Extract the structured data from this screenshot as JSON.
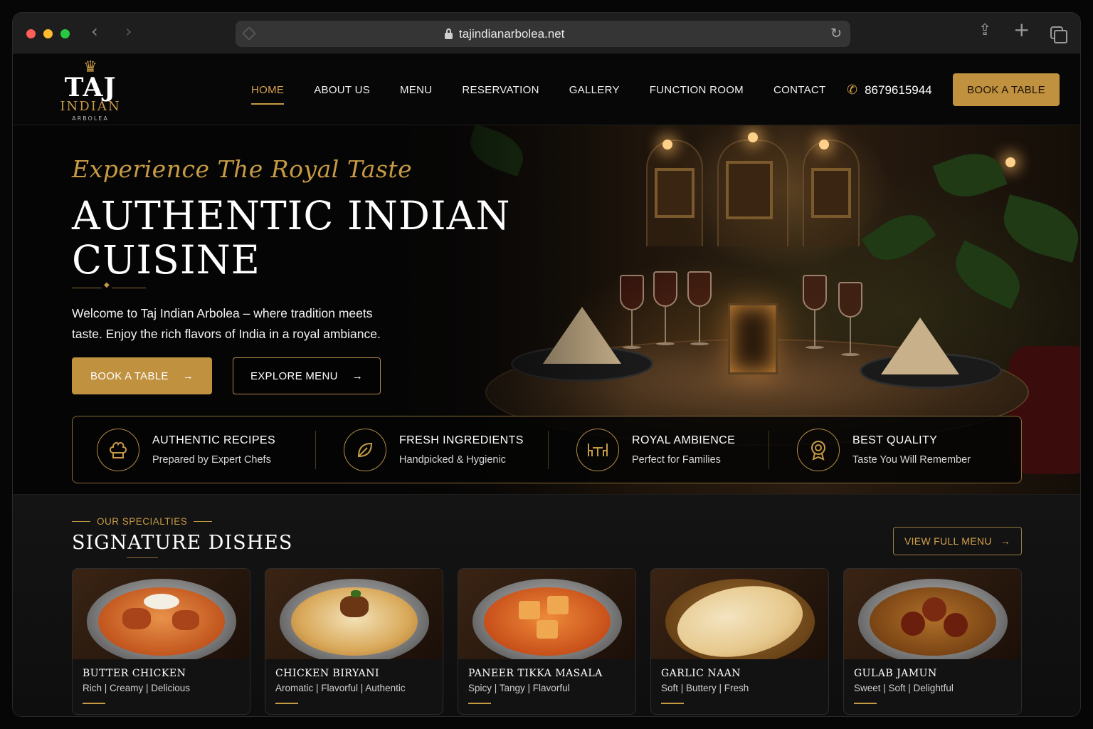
{
  "browser": {
    "url": "tajindianarbolea.net"
  },
  "logo": {
    "name": "TAJ",
    "subname": "INDIAN",
    "location": "ARBOLEA"
  },
  "nav": {
    "items": [
      {
        "label": "HOME",
        "active": true
      },
      {
        "label": "ABOUT US",
        "active": false
      },
      {
        "label": "MENU",
        "active": false
      },
      {
        "label": "RESERVATION",
        "active": false
      },
      {
        "label": "GALLERY",
        "active": false
      },
      {
        "label": "FUNCTION ROOM",
        "active": false
      },
      {
        "label": "CONTACT",
        "active": false
      }
    ],
    "phone": "8679615944",
    "book_label": "BOOK A TABLE"
  },
  "hero": {
    "tagline": "Experience The Royal Taste",
    "headline_line1": "AUTHENTIC INDIAN",
    "headline_line2": "CUISINE",
    "intro": "Welcome to Taj Indian Arbolea – where tradition meets taste. Enjoy the rich flavors of India in a royal ambiance.",
    "primary_btn": "BOOK A TABLE",
    "secondary_btn": "EXPLORE MENU"
  },
  "features": [
    {
      "icon": "chef-hat-icon",
      "title": "AUTHENTIC RECIPES",
      "subtitle": "Prepared by Expert Chefs"
    },
    {
      "icon": "leaf-icon",
      "title": "FRESH INGREDIENTS",
      "subtitle": "Handpicked & Hygienic"
    },
    {
      "icon": "dining-table-icon",
      "title": "ROYAL AMBIENCE",
      "subtitle": "Perfect for Families"
    },
    {
      "icon": "award-badge-icon",
      "title": "BEST QUALITY",
      "subtitle": "Taste You Will Remember"
    }
  ],
  "specialties": {
    "eyebrow": "OUR SPECIALTIES",
    "title": "SIGNATURE DISHES",
    "view_btn": "VIEW FULL MENU",
    "dishes": [
      {
        "name": "BUTTER CHICKEN",
        "desc": "Rich | Creamy | Delicious"
      },
      {
        "name": "CHICKEN BIRYANI",
        "desc": "Aromatic | Flavorful | Authentic"
      },
      {
        "name": "PANEER TIKKA MASALA",
        "desc": "Spicy | Tangy | Flavorful"
      },
      {
        "name": "GARLIC NAAN",
        "desc": "Soft | Buttery | Fresh"
      },
      {
        "name": "GULAB JAMUN",
        "desc": "Sweet | Soft | Delightful"
      }
    ]
  },
  "colors": {
    "accent_gold": "#c0913f",
    "background": "#080808"
  }
}
